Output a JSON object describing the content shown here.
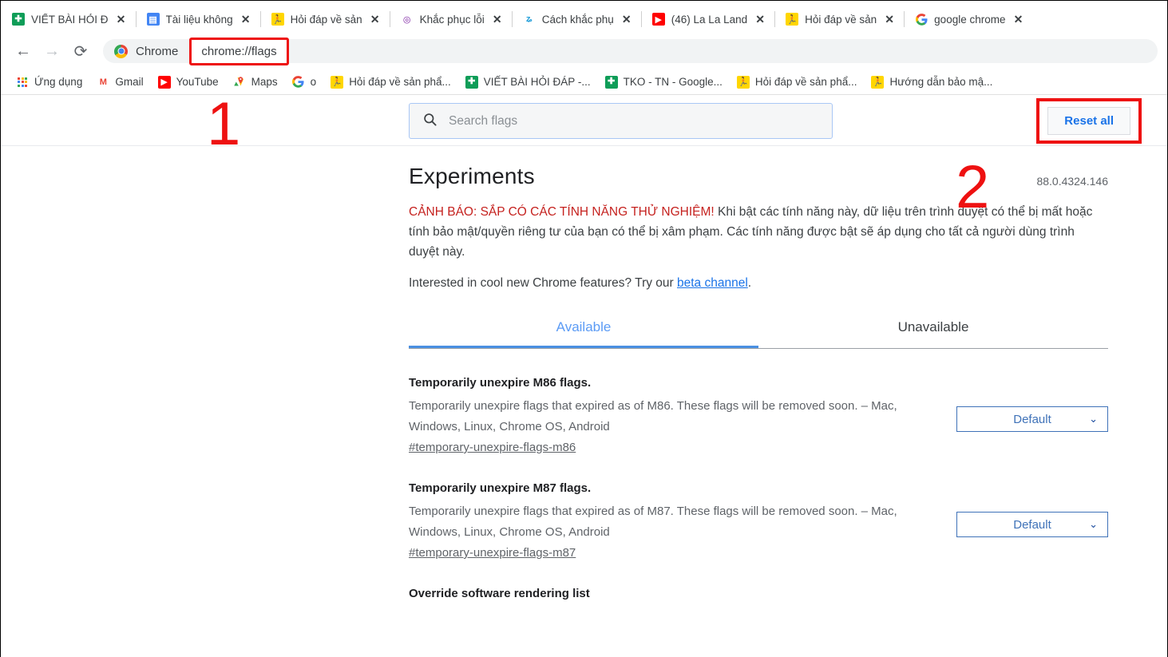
{
  "browser": {
    "tabs": [
      {
        "title": "VIẾT BÀI HỎI Đ",
        "icon": "google-sheets-icon",
        "close": "✕"
      },
      {
        "title": "Tài liệu không",
        "icon": "google-docs-icon",
        "close": "✕"
      },
      {
        "title": "Hỏi đáp về sản",
        "icon": "runner-icon",
        "close": "✕"
      },
      {
        "title": "Khắc phục lỗi",
        "icon": "purple-ring-icon",
        "close": "✕"
      },
      {
        "title": "Cách khắc phụ",
        "icon": "blue-glyph-icon",
        "close": "✕"
      },
      {
        "title": "(46) La La Land",
        "icon": "youtube-icon",
        "close": "✕"
      },
      {
        "title": "Hỏi đáp về sản",
        "icon": "runner-icon",
        "close": "✕"
      },
      {
        "title": "google chrome",
        "icon": "google-icon",
        "close": "✕"
      }
    ],
    "toolbar": {
      "back": "←",
      "forward": "→",
      "reload": "⟳",
      "scheme_label": "Chrome",
      "url": "chrome://flags"
    },
    "bookmarks": [
      {
        "label": "Ứng dụng",
        "icon": "apps-grid-icon"
      },
      {
        "label": "Gmail",
        "icon": "gmail-icon"
      },
      {
        "label": "YouTube",
        "icon": "youtube-icon"
      },
      {
        "label": "Maps",
        "icon": "google-maps-icon"
      },
      {
        "label": "o",
        "icon": "google-icon"
      },
      {
        "label": "Hỏi đáp về sản phẩ...",
        "icon": "runner-icon"
      },
      {
        "label": "VIẾT BÀI HỎI ĐÁP -...",
        "icon": "google-sheets-icon"
      },
      {
        "label": "TKO - TN - Google...",
        "icon": "google-sheets-icon"
      },
      {
        "label": "Hỏi đáp về sản phẩ...",
        "icon": "runner-icon"
      },
      {
        "label": "Hướng dẫn bảo mậ...",
        "icon": "runner-icon"
      }
    ]
  },
  "flags_page": {
    "search": {
      "placeholder": "Search flags",
      "value": "",
      "icon": "search-icon"
    },
    "reset_all_label": "Reset all",
    "title": "Experiments",
    "version": "88.0.4324.146",
    "warning": {
      "red_part": "CẢNH BÁO: SẮP CÓ CÁC TÍNH NĂNG THỬ NGHIỆM!",
      "rest": " Khi bật các tính năng này, dữ liệu trên trình duyệt có thể bị mất hoặc tính bảo mật/quyền riêng tư của bạn có thể bị xâm phạm. Các tính năng được bật sẽ áp dụng cho tất cả người dùng trình duyệt này."
    },
    "beta": {
      "before": "Interested in cool new Chrome features? Try our ",
      "link": "beta channel",
      "after": "."
    },
    "tabs": [
      {
        "label": "Available",
        "active": true
      },
      {
        "label": "Unavailable",
        "active": false
      }
    ],
    "flags": [
      {
        "name": "Temporarily unexpire M86 flags.",
        "description": "Temporarily unexpire flags that expired as of M86. These flags will be removed soon. – Mac, Windows, Linux, Chrome OS, Android",
        "permalink": "#temporary-unexpire-flags-m86",
        "select_value": "Default",
        "has_select": true
      },
      {
        "name": "Temporarily unexpire M87 flags.",
        "description": "Temporarily unexpire flags that expired as of M87. These flags will be removed soon. – Mac, Windows, Linux, Chrome OS, Android",
        "permalink": "#temporary-unexpire-flags-m87",
        "select_value": "Default",
        "has_select": true
      },
      {
        "name": "Override software rendering list",
        "description": "",
        "permalink": "",
        "select_value": "",
        "has_select": false
      }
    ]
  },
  "annotations": {
    "marker_1": "1",
    "marker_2": "2",
    "highlight_color": "#ee1111"
  }
}
